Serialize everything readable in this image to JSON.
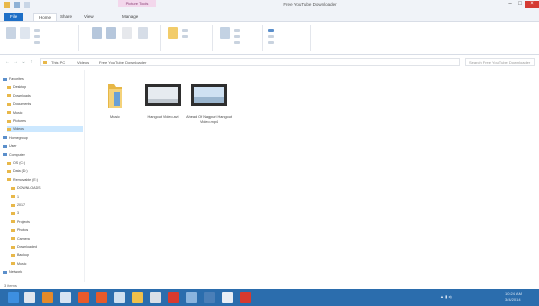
{
  "titlebar": {
    "title": "Free YouTube Downloader",
    "context_tab": "Picture Tools"
  },
  "tabs": {
    "file": "File",
    "home": "Home",
    "share": "Share",
    "view": "View",
    "manage": "Manage"
  },
  "address": {
    "crumbs": [
      "This PC",
      "Videos",
      "Free YouTube Downloader"
    ],
    "search_placeholder": "Search Free YouTube Downloader"
  },
  "navpane": {
    "items": [
      {
        "label": "Favorites",
        "level": 0
      },
      {
        "label": "Desktop",
        "level": 1
      },
      {
        "label": "Downloads",
        "level": 1
      },
      {
        "label": "Documents",
        "level": 1
      },
      {
        "label": "Music",
        "level": 1
      },
      {
        "label": "Pictures",
        "level": 1
      },
      {
        "label": "Videos",
        "level": 1,
        "selected": true
      },
      {
        "label": "Homegroup",
        "level": 0
      },
      {
        "label": "User",
        "level": 0
      },
      {
        "label": "Computer",
        "level": 0
      },
      {
        "label": "OS (C:)",
        "level": 1
      },
      {
        "label": "Data (D:)",
        "level": 1
      },
      {
        "label": "Removable (E:)",
        "level": 1
      },
      {
        "label": "DOWNLOADS",
        "level": 2
      },
      {
        "label": "1",
        "level": 2
      },
      {
        "label": "2017",
        "level": 2
      },
      {
        "label": "3",
        "level": 2
      },
      {
        "label": "Projects",
        "level": 2
      },
      {
        "label": "Photos",
        "level": 2
      },
      {
        "label": "Camera",
        "level": 2
      },
      {
        "label": "Downloaded",
        "level": 2
      },
      {
        "label": "Backup",
        "level": 2
      },
      {
        "label": "Music",
        "level": 2
      },
      {
        "label": "Network",
        "level": 0
      }
    ]
  },
  "content": {
    "tiles": [
      {
        "label": "Music",
        "kind": "folder"
      },
      {
        "label": "Hangout Video.avi",
        "kind": "video"
      },
      {
        "label": "Ahead Of Nagpuri Hangout Video.mp4",
        "kind": "video"
      }
    ]
  },
  "status": {
    "text": "3 items"
  },
  "taskbar": {
    "time": "10:24 AM",
    "date": "3/4/2014"
  },
  "colors": {
    "accent": "#1e6fc7",
    "taskbar": "#2b6dad",
    "selection": "#cce8ff"
  }
}
